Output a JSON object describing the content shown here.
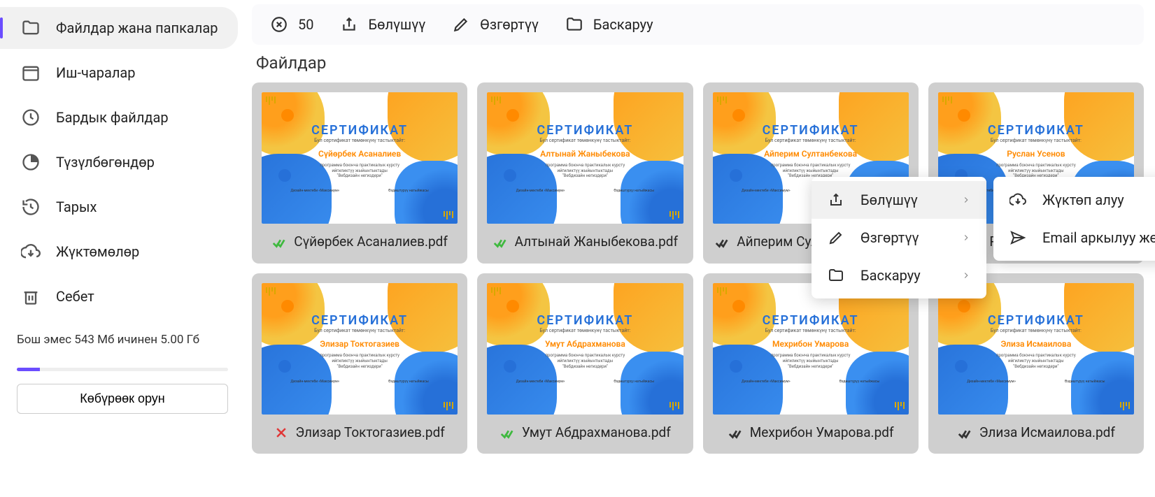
{
  "sidebar": {
    "items": [
      {
        "label": "Файлдар жана папкалар"
      },
      {
        "label": "Иш-чаралар"
      },
      {
        "label": "Бардык файлдар"
      },
      {
        "label": "Түзүлбөгөндөр"
      },
      {
        "label": "Тарых"
      },
      {
        "label": "Жүктөмөлөр"
      },
      {
        "label": "Себет"
      }
    ],
    "storage_text": "Бош эмес 543 Мб ичинен 5.00 Гб",
    "more_space": "Көбүрөөк орун"
  },
  "toolbar": {
    "count": "50",
    "share": "Бөлүшүү",
    "edit": "Өзгөртүү",
    "manage": "Баскаруу"
  },
  "section_title": "Файлдар",
  "files": [
    {
      "cert_name": "Сүйөрбек Асаналиев",
      "filename": "Сүйөрбек Асаналиев.pdf",
      "status": "ok-green"
    },
    {
      "cert_name": "Алтынай Жаныбекова",
      "filename": "Алтынай Жаныбекова.pdf",
      "status": "ok-green"
    },
    {
      "cert_name": "Айперим Султанбекова",
      "filename": "Айперим Султанбекова.pdf",
      "status": "ok-dark"
    },
    {
      "cert_name": "Руслан Усенов",
      "filename": "Руслан Усенов.pdf",
      "status": "ok-dark"
    },
    {
      "cert_name": "Элизар Токтогазиев",
      "filename": "Элизар Токтогазиев.pdf",
      "status": "error"
    },
    {
      "cert_name": "Умут Абдрахманова",
      "filename": "Умут Абдрахманова.pdf",
      "status": "ok-green"
    },
    {
      "cert_name": "Мехрибон Умарова",
      "filename": "Мехрибон Умарова.pdf",
      "status": "ok-dark"
    },
    {
      "cert_name": "Элиза Исмаилова",
      "filename": "Элиза Исмаилова.pdf",
      "status": "ok-dark"
    }
  ],
  "cert_common": {
    "title": "СЕРТИФИКАТ",
    "sub": "Бул сертификат төмөнкүнү тастыктайт:",
    "desc1": "программа боюнча практикалык курсту",
    "desc2": "ийгиликтүү жыйынтыктады",
    "desc3": "\"Вебдизайн негиздери\"",
    "foot_l": "Дизайн-мектеби «Максимум»",
    "foot_r": "Өздөштүрүү натыйжасы"
  },
  "context_menu": {
    "share": "Бөлүшүү",
    "edit": "Өзгөртүү",
    "manage": "Баскаруу"
  },
  "sub_menu": {
    "download": "Жүктөп алуу",
    "email": "Email аркылуу жөнөтүү"
  }
}
